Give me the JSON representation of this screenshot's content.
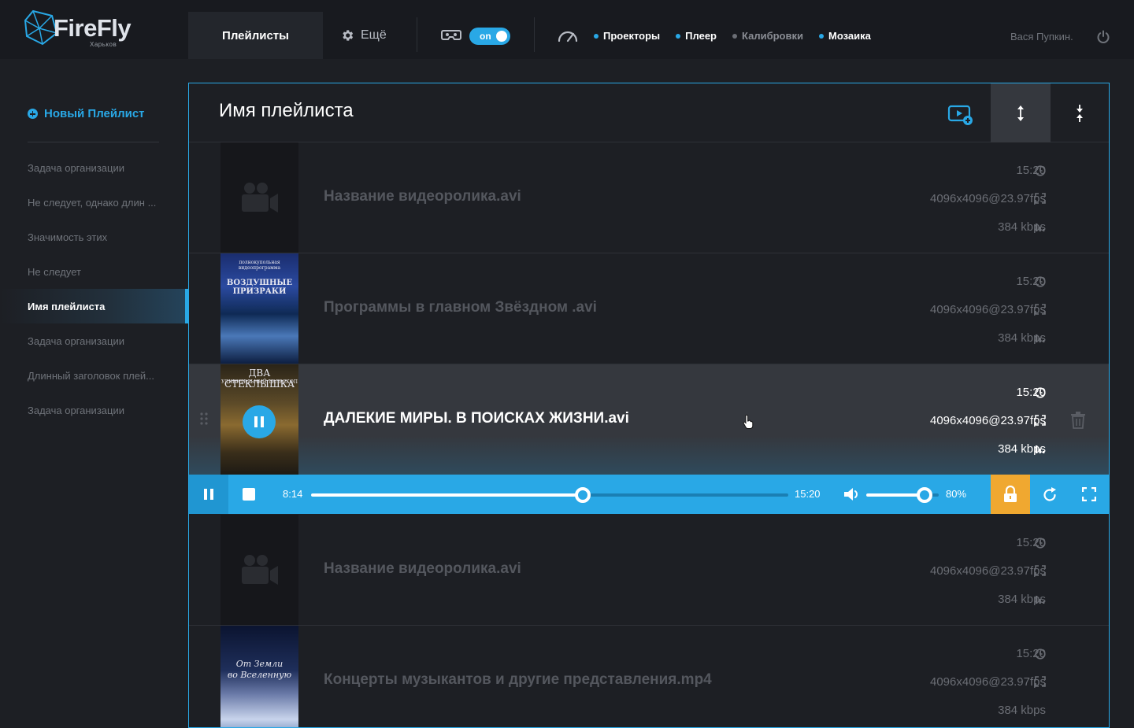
{
  "brand": {
    "name": "FireFly",
    "city": "Харьков"
  },
  "header": {
    "tab_playlists": "Плейлисты",
    "tab_more": "Ещё",
    "toggle_label": "on",
    "nav": [
      {
        "label": "Проекторы",
        "active": true
      },
      {
        "label": "Плеер",
        "active": true
      },
      {
        "label": "Калибровки",
        "active": false
      },
      {
        "label": "Мозаика",
        "active": true
      }
    ],
    "user": "Вася Пупкин."
  },
  "sidebar": {
    "new_playlist": "Новый Плейлист",
    "items": [
      {
        "label": "Задача организации"
      },
      {
        "label": "Не следует, однако длин ..."
      },
      {
        "label": "Значимость этих"
      },
      {
        "label": "Не следует"
      },
      {
        "label": "Имя плейлиста",
        "active": true
      },
      {
        "label": "Задача организации"
      },
      {
        "label": "Длинный заголовок плей..."
      },
      {
        "label": "Задача организации"
      }
    ]
  },
  "playlist": {
    "title": "Имя плейлиста",
    "rows": [
      {
        "title": "Название видеоролика.avi",
        "duration": "15:20",
        "resolution": "4096x4096@23.97fps",
        "bitrate": "384 kbps",
        "thumb": "placeholder"
      },
      {
        "title": "Программы в главном Звёздном .avi",
        "duration": "15:20",
        "resolution": "4096x4096@23.97fps",
        "bitrate": "384 kbps",
        "thumb": "poster",
        "poster_text_1": "ВОЗДУШНЫЕ ПРИЗРАКИ",
        "poster_text_2": "полнокупольная видеопрограмма"
      },
      {
        "title": "ДАЛЕКИЕ МИРЫ. В ПОИСКАХ ЖИЗНИ.avi",
        "duration": "15:20",
        "resolution": "4096x4096@23.97fps",
        "bitrate": "384 kbps",
        "thumb": "poster",
        "current": true,
        "poster_text_1": "ДВА СТЕКЛЫШКА",
        "poster_text_2": "УДИВИТЕЛЬНЫЙ ТЕЛЕСКОП"
      },
      {
        "title": "Название видеоролика.avi",
        "duration": "15:20",
        "resolution": "4096x4096@23.97fps",
        "bitrate": "384 kbps",
        "thumb": "placeholder"
      },
      {
        "title": "Концерты музыкантов и другие представления.mp4",
        "duration": "15:20",
        "resolution": "4096x4096@23.97fps",
        "bitrate": "384 kbps",
        "thumb": "poster",
        "poster_text_1": "От Земли",
        "poster_text_2": "во Вселенную"
      }
    ]
  },
  "player": {
    "current_time": "8:14",
    "total_time": "15:20",
    "progress": 0.57,
    "volume": 0.8,
    "volume_label": "80%"
  },
  "colors": {
    "accent": "#29a8e6",
    "lock": "#f0a830",
    "background": "#1d1f24"
  }
}
